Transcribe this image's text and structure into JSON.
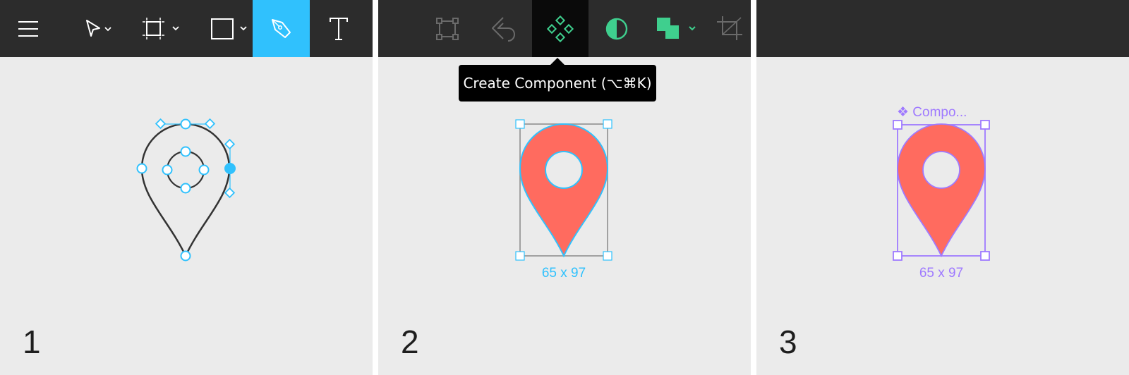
{
  "colors": {
    "toolbar_bg": "#2c2c2c",
    "canvas_bg": "#ebebeb",
    "selection_blue": "#30c1fd",
    "component_purple": "#9f7aff",
    "pin_fill": "#ff6b5f",
    "component_green": "#3fcf8e"
  },
  "panels": [
    {
      "step_number": "1",
      "toolbar": [
        {
          "icon": "hamburger-menu-icon"
        },
        {
          "icon": "move-tool-icon",
          "has_dropdown": true
        },
        {
          "icon": "frame-tool-icon",
          "has_dropdown": true
        },
        {
          "icon": "rectangle-tool-icon",
          "has_dropdown": true
        },
        {
          "icon": "pen-tool-icon",
          "active": true
        },
        {
          "icon": "text-tool-icon"
        }
      ]
    },
    {
      "step_number": "2",
      "toolbar": [
        {
          "icon": "edit-object-icon"
        },
        {
          "icon": "reset-icon"
        },
        {
          "icon": "create-component-icon",
          "active": true
        },
        {
          "icon": "mask-icon"
        },
        {
          "icon": "boolean-union-icon",
          "has_dropdown": true
        },
        {
          "icon": "crop-icon"
        }
      ],
      "tooltip": "Create Component (⌥⌘K)",
      "dimension_label": "65 x 97"
    },
    {
      "step_number": "3",
      "component_label": "❖ Compo...",
      "dimension_label": "65 x 97"
    }
  ]
}
